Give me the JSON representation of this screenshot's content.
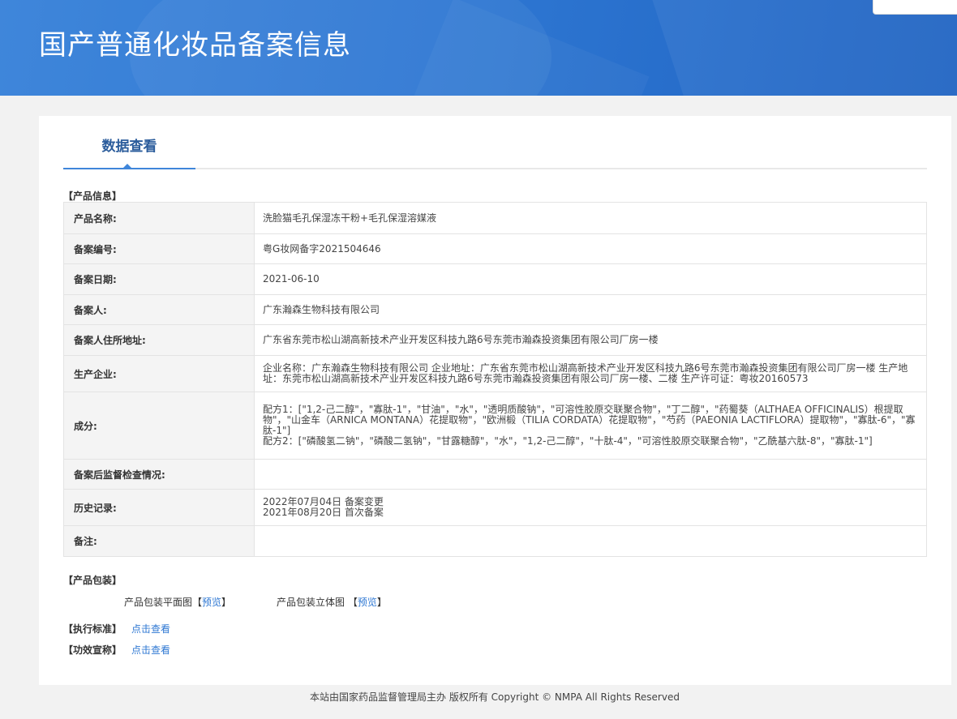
{
  "header": {
    "title": "国产普通化妆品备案信息"
  },
  "tab": {
    "label": "数据查看"
  },
  "product_info": {
    "section_title": "【产品信息】",
    "rows": [
      {
        "label": "产品名称:",
        "value": "洗脸猫毛孔保湿冻干粉+毛孔保湿溶媒液"
      },
      {
        "label": "备案编号:",
        "value": "粤G妆网备字2021504646"
      },
      {
        "label": "备案日期:",
        "value": "2021-06-10"
      },
      {
        "label": "备案人:",
        "value": "广东瀚森生物科技有限公司"
      },
      {
        "label": "备案人住所地址:",
        "value": "广东省东莞市松山湖高新技术产业开发区科技九路6号东莞市瀚森投资集团有限公司厂房一楼"
      },
      {
        "label": "生产企业:",
        "value": "企业名称：广东瀚森生物科技有限公司 企业地址：广东省东莞市松山湖高新技术产业开发区科技九路6号东莞市瀚森投资集团有限公司厂房一楼 生产地址：东莞市松山湖高新技术产业开发区科技九路6号东莞市瀚森投资集团有限公司厂房一楼、二楼 生产许可证：粤妆20160573"
      },
      {
        "label": "成分:",
        "value": "配方1：[\"1,2-己二醇\"，\"寡肽-1\"，\"甘油\"，\"水\"，\"透明质酸钠\"，\"可溶性胶原交联聚合物\"，\"丁二醇\"，\"药蜀葵（ALTHAEA OFFICINALIS）根提取物\"，\"山金车（ARNICA MONTANA）花提取物\"，\"欧洲椴（TILIA CORDATA）花提取物\"，\"芍药（PAEONIA LACTIFLORA）提取物\"，\"寡肽-6\"，\"寡肽-1\"]",
        "value2": "配方2：[\"磷酸氢二钠\"，\"磷酸二氢钠\"，\"甘露糖醇\"，\"水\"，\"1,2-己二醇\"，\"十肽-4\"，\"可溶性胶原交联聚合物\"，\"乙酰基六肽-8\"，\"寡肽-1\"]"
      },
      {
        "label": "备案后监督检查情况:",
        "value": ""
      },
      {
        "label": "历史记录:",
        "value": "2022年07月04日 备案变更",
        "value2": "2021年08月20日 首次备案"
      },
      {
        "label": "备注:",
        "value": ""
      }
    ]
  },
  "packaging": {
    "section_title": "【产品包装】",
    "flat_label": "产品包装平面图",
    "flat_bracket_open": "【",
    "flat_link": "预览",
    "flat_bracket_close": "】",
    "solid_label": "产品包装立体图",
    "solid_bracket_open": "【",
    "solid_link": "预览",
    "solid_bracket_close": "】"
  },
  "standard": {
    "section_title": "【执行标准】",
    "link": "点击查看"
  },
  "efficacy": {
    "section_title": "【功效宣称】",
    "link": "点击查看"
  },
  "footer": {
    "text": "本站由国家药品监督管理局主办 版权所有 Copyright © NMPA All Rights Reserved"
  }
}
